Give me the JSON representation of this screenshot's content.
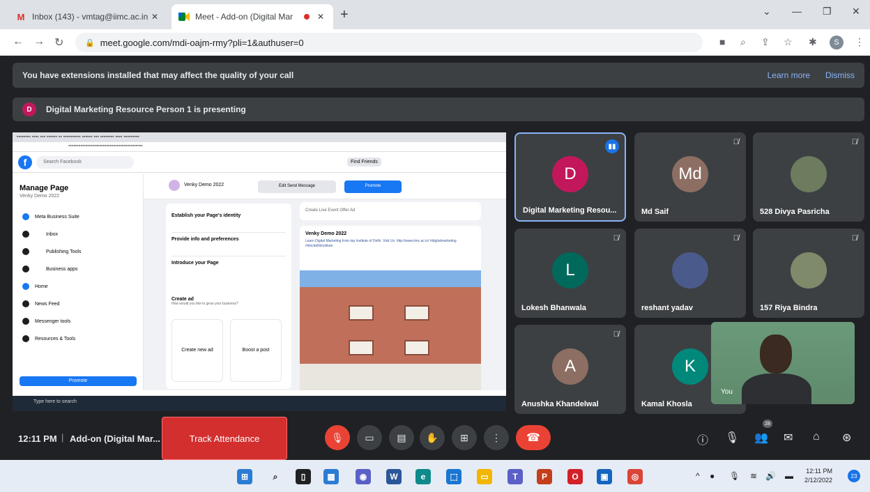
{
  "browser": {
    "tabs": [
      {
        "title": "Inbox (143) - vmtag@iimc.ac.in",
        "favicon": "gmail-icon",
        "active": false
      },
      {
        "title": "Meet - Add-on (Digital Mar",
        "favicon": "meet-icon",
        "active": true
      }
    ],
    "url": "meet.google.com/mdi-oajm-rmy?pli=1&authuser=0",
    "profile_initial": "S"
  },
  "banners": {
    "extensions_text": "You have extensions installed that may affect the quality of your call",
    "learn_more": "Learn more",
    "dismiss": "Dismiss",
    "presenting_initial": "D",
    "presenting_text": "Digital Marketing Resource Person 1 is presenting"
  },
  "presentation": {
    "fb_search": "Search Facebook",
    "find_friends": "Find Friends",
    "sidebar_title": "Manage Page",
    "sidebar_sub": "Venky Demo 2022",
    "sidebar_items": [
      "Meta Business Suite",
      "Inbox",
      "Publishing Tools",
      "Business apps",
      "Home",
      "News Feed",
      "Messenger tools",
      "Resources & Tools"
    ],
    "promote": "Promote",
    "page_name": "Venky Demo 2022",
    "edit_send_message": "Edit Send Message",
    "promote_button": "Promote",
    "steps": [
      {
        "label": "Establish your Page's identity"
      },
      {
        "label": "Provide info and preferences"
      },
      {
        "label": "Introduce your Page"
      }
    ],
    "create_ad_title": "Create ad",
    "create_ad_sub": "How would you like to grow your business?",
    "create_new_ad": "Create new ad",
    "boost_post": "Boost a post",
    "create_bar": "Create  Live  Event  Offer  Ad",
    "post_author": "Venky Demo 2022",
    "post_text": "Learn Digital Marketing from top Institute of Delhi. Visit Us: http://www.iimc.ac.in/ #digitalmarketing #iimcdelhiinstitute",
    "taskbar_search": "Type here to search"
  },
  "participants": [
    {
      "name": "Digital Marketing Resou...",
      "initial": "D",
      "color": "#c2185b",
      "speaking": true
    },
    {
      "name": "Md Saif",
      "initial": "Md",
      "color": "#8d6e63",
      "speaking": false
    },
    {
      "name": "528 Divya Pasricha",
      "initial": "",
      "color": "#6d7b5e",
      "speaking": false
    },
    {
      "name": "Lokesh Bhanwala",
      "initial": "L",
      "color": "#00695c",
      "speaking": false
    },
    {
      "name": "reshant yadav",
      "initial": "",
      "color": "#4a5a8a",
      "speaking": false
    },
    {
      "name": "157 Riya Bindra",
      "initial": "",
      "color": "#7f8a6a",
      "speaking": false
    },
    {
      "name": "Anushka Khandelwal",
      "initial": "A",
      "color": "#8d6e63",
      "speaking": false
    },
    {
      "name": "Kamal Khosla",
      "initial": "K",
      "color": "#00897b",
      "speaking": false
    }
  ],
  "self_label": "You",
  "meeting": {
    "time": "12:11 PM",
    "name": "Add-on (Digital Mar...",
    "track_attendance": "Track Attendance",
    "people_count": "28"
  },
  "taskbar": {
    "time": "12:11 PM",
    "date": "2/12/2022",
    "notifications": "23"
  }
}
